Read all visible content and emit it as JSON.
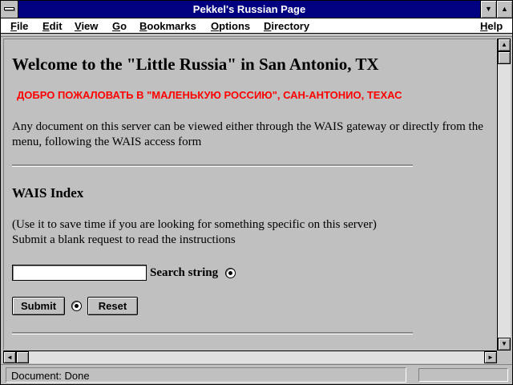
{
  "window": {
    "title": "Pekkel's Russian Page"
  },
  "titlebar_buttons": {
    "minimize_icon": "down-triangle",
    "maximize_icon": "up-triangle"
  },
  "menubar": {
    "items": [
      {
        "ul": "F",
        "rest": "ile"
      },
      {
        "ul": "E",
        "rest": "dit"
      },
      {
        "ul": "V",
        "rest": "iew"
      },
      {
        "ul": "G",
        "rest": "o"
      },
      {
        "ul": "B",
        "rest": "ookmarks"
      },
      {
        "ul": "O",
        "rest": "ptions"
      },
      {
        "ul": "D",
        "rest": "irectory"
      },
      {
        "ul": "H",
        "rest": "elp"
      }
    ]
  },
  "page": {
    "heading": "Welcome to the \"Little Russia\" in San Antonio, TX",
    "russian_greeting": "ДОБРО ПОЖАЛОВАТЬ В \"МАЛЕНЬКУЮ РОССИЮ\", САН-АНТОНИО, ТЕХАС",
    "intro": "Any document on this server can be viewed either through the WAIS gateway or directly from the menu, following the WAIS access form",
    "wais_heading": "WAIS Index",
    "wais_line1": "(Use it to save time if you are looking for something specific on this server)",
    "wais_line2": "Submit a blank request to read the instructions",
    "search_value": "",
    "search_label": "Search string",
    "submit_label": "Submit",
    "reset_label": "Reset"
  },
  "status": {
    "text": "Document: Done"
  },
  "colors": {
    "titlebar": "#000080",
    "russian_text": "#ff0000",
    "background": "#c0c0c0"
  }
}
